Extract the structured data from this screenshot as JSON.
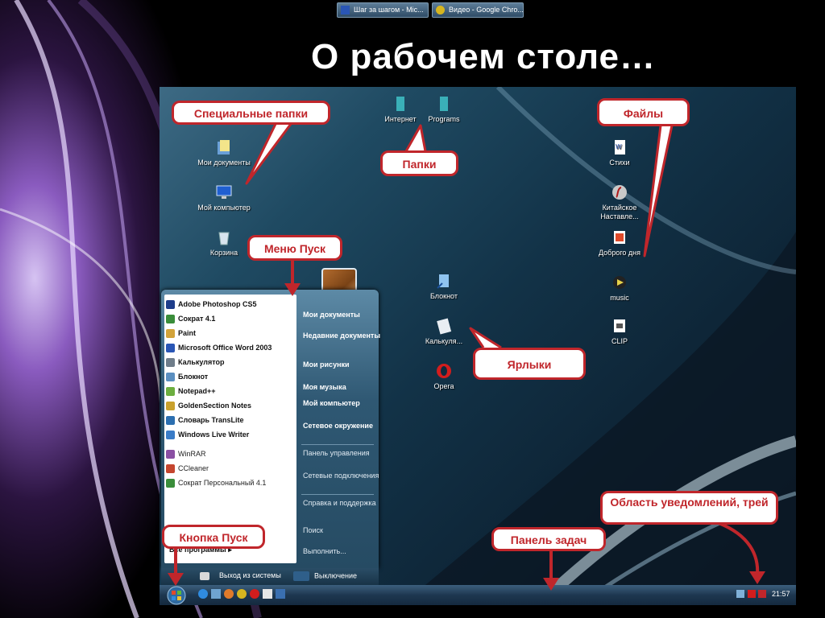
{
  "title": "О рабочем столе…",
  "desktop_icons": {
    "my_documents": "Мои документы",
    "my_computer": "Мой компьютер",
    "recycle_bin": "Корзина",
    "internet": "Интернет",
    "programs": "Programs",
    "notepad": "Блокнот",
    "calculator": "Калькуля...",
    "opera": "Opera",
    "stihi": "Стихи",
    "chinese_teacher": "Китайское Наставле...",
    "good_day": "Доброго дня",
    "music": "music",
    "clip": "CLIP"
  },
  "callouts": {
    "special_folders": "Специальные папки",
    "folders": "Папки",
    "files": "Файлы",
    "start_menu": "Меню Пуск",
    "shortcuts": "Ярлыки",
    "start_button": "Кнопка Пуск",
    "taskbar": "Панель задач",
    "notification_area": "Область уведомлений, трей"
  },
  "start_menu": {
    "programs": [
      {
        "label": "Adobe Photoshop CS5",
        "color": "#1e3d8a"
      },
      {
        "label": "Сократ 4.1",
        "color": "#3a8d3a"
      },
      {
        "label": "Paint",
        "color": "#d2a33a"
      },
      {
        "label": "Microsoft Office Word 2003",
        "color": "#2a56b5"
      },
      {
        "label": "Калькулятор",
        "color": "#6f7d8a"
      },
      {
        "label": "Блокнот",
        "color": "#5b8fc0"
      },
      {
        "label": "Notepad++",
        "color": "#6cae3f"
      },
      {
        "label": "GoldenSection Notes",
        "color": "#c9a12d"
      },
      {
        "label": "Словарь TransLite",
        "color": "#2c6fb0"
      },
      {
        "label": "Windows Live Writer",
        "color": "#3a7cc7"
      },
      {
        "label": "WinRAR",
        "color": "#8a4fa3"
      },
      {
        "label": "CCleaner",
        "color": "#c5462f"
      },
      {
        "label": "Сократ Персональный 4.1",
        "color": "#3a8d3a"
      }
    ],
    "all_programs": "Все программы",
    "right": {
      "my_documents": "Мои документы",
      "recent_documents": "Недавние документы",
      "my_pictures": "Мои рисунки",
      "my_music": "Моя музыка",
      "my_computer": "Мой компьютер",
      "network": "Сетевое окружение",
      "control_panel": "Панель управления",
      "network_connections": "Сетевые подключения",
      "help": "Справка и поддержка",
      "search": "Поиск",
      "run": "Выполнить..."
    },
    "logoff": "Выход из системы",
    "shutdown": "Выключение"
  },
  "taskbar": {
    "task1": "Шаг за шагом - Mic...",
    "task2": "Видео - Google Chro...",
    "clock": "21:57"
  },
  "colors": {
    "callout_border": "#c0262b",
    "arrow": "#c0262b"
  }
}
